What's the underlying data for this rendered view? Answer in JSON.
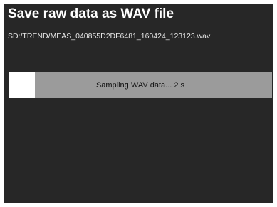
{
  "dialog": {
    "title": "Save raw data as WAV file",
    "file_path": "SD:/TREND/MEAS_040855D2DF6481_160424_123123.wav"
  },
  "progress": {
    "label": "Sampling WAV data... 2 s",
    "fraction": 0.1,
    "fill_color": "#ffffff",
    "track_color": "#9b9b9b"
  },
  "colors": {
    "screen_background": "#272727",
    "frame": "#ffffff",
    "title_text": "#ffffff"
  }
}
